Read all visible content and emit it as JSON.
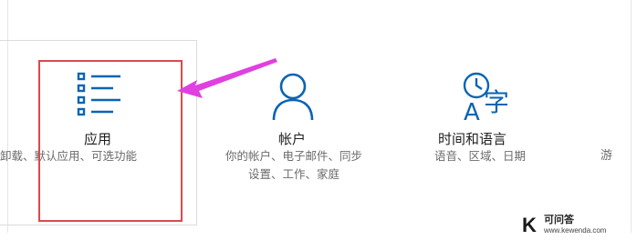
{
  "tiles": [
    {
      "id": "apps",
      "icon": "app-list-icon",
      "title": "应用",
      "description": [
        "卸载、默认应用、可选功能"
      ]
    },
    {
      "id": "accounts",
      "icon": "person-icon",
      "title": "帐户",
      "description": [
        "你的帐户、电子邮件、同步",
        "设置、工作、家庭"
      ]
    },
    {
      "id": "time-language",
      "icon": "time-language-icon",
      "title": "时间和语言",
      "description": [
        "语音、区域、日期"
      ]
    }
  ],
  "partial_tile_text": "游",
  "annotation": {
    "highlight_color": "#d94a4a",
    "arrow_color": "#e040e0"
  },
  "accent_color": "#0a64b4",
  "watermark": {
    "letter": "K",
    "name": "可问答",
    "url": "www.kewenda.com"
  }
}
